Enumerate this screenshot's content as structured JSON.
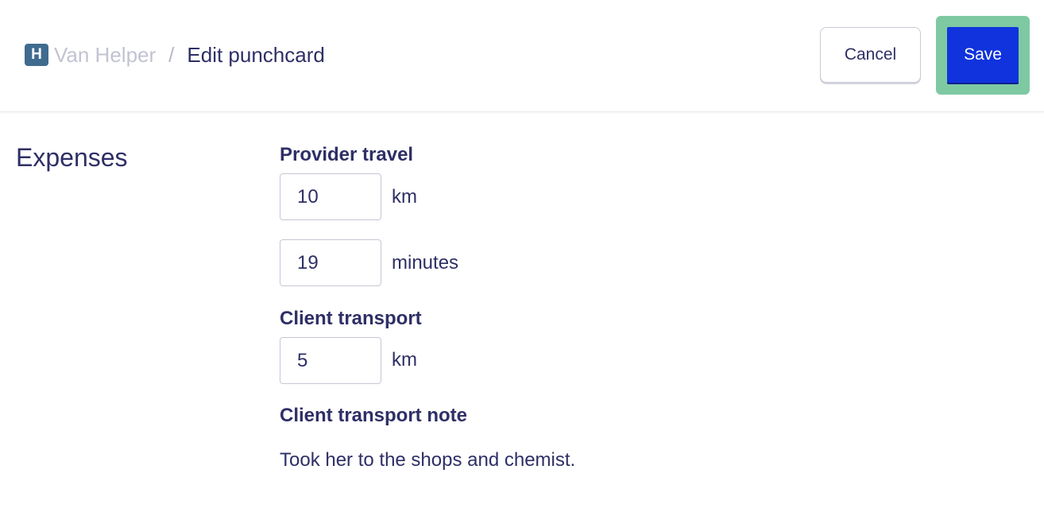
{
  "header": {
    "org_badge_letter": "H",
    "org_name": "Van Helper",
    "separator": "/",
    "page_title": "Edit punchcard",
    "cancel_label": "Cancel",
    "save_label": "Save"
  },
  "section": {
    "title": "Expenses"
  },
  "provider_travel": {
    "label": "Provider travel",
    "distance_value": "10",
    "distance_unit": "km",
    "duration_value": "19",
    "duration_unit": "minutes"
  },
  "client_transport": {
    "label": "Client transport",
    "distance_value": "5",
    "distance_unit": "km"
  },
  "client_transport_note": {
    "label": "Client transport note",
    "text": "Took her to the shops and chemist."
  },
  "colors": {
    "primary": "#1033dd",
    "focus_ring": "#7ec9a2",
    "text": "#2e2f66",
    "muted": "#c2c3d2",
    "org_badge": "#3f6b8e"
  }
}
